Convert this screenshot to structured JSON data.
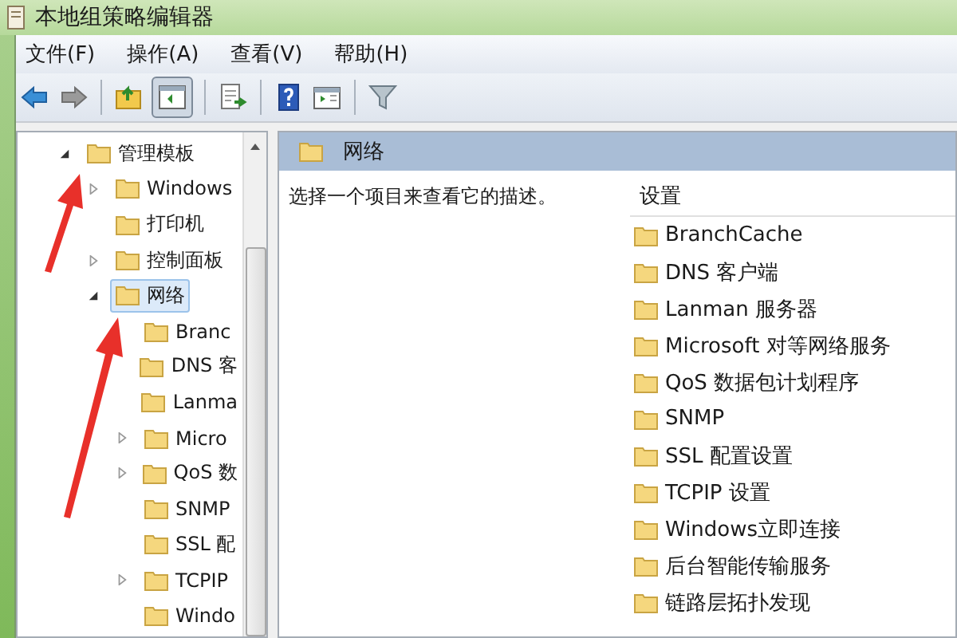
{
  "window": {
    "title": "本地组策略编辑器"
  },
  "menu": [
    {
      "label": "文件(F)"
    },
    {
      "label": "操作(A)"
    },
    {
      "label": "查看(V)"
    },
    {
      "label": "帮助(H)"
    }
  ],
  "toolbar": [
    {
      "kind": "back"
    },
    {
      "kind": "forward"
    },
    {
      "kind": "sep"
    },
    {
      "kind": "up"
    },
    {
      "kind": "tree",
      "pressed": true
    },
    {
      "kind": "sep"
    },
    {
      "kind": "export"
    },
    {
      "kind": "sep"
    },
    {
      "kind": "help"
    },
    {
      "kind": "pane"
    },
    {
      "kind": "sep"
    },
    {
      "kind": "filter"
    }
  ],
  "tree": [
    {
      "label": "管理模板",
      "expanded": true,
      "selected": false,
      "children": [
        {
          "label": "Windows",
          "expanded": false,
          "selected": false
        },
        {
          "label": "打印机",
          "selected": false
        },
        {
          "label": "控制面板",
          "expanded": false,
          "selected": false
        },
        {
          "label": "网络",
          "expanded": true,
          "selected": true,
          "children": [
            {
              "label": "Branc",
              "selected": false
            },
            {
              "label": "DNS 客",
              "selected": false
            },
            {
              "label": "Lanma",
              "selected": false
            },
            {
              "label": "Micro",
              "expanded": false,
              "selected": false
            },
            {
              "label": "QoS 数",
              "expanded": false,
              "selected": false
            },
            {
              "label": "SNMP",
              "selected": false
            },
            {
              "label": "SSL 配",
              "selected": false
            },
            {
              "label": "TCPIP",
              "expanded": false,
              "selected": false
            },
            {
              "label": "Windo",
              "selected": false
            }
          ]
        }
      ]
    }
  ],
  "details": {
    "heading": "网络",
    "description": "选择一个项目来查看它的描述。",
    "column": "设置",
    "items": [
      {
        "label": "BranchCache"
      },
      {
        "label": "DNS 客户端"
      },
      {
        "label": "Lanman 服务器"
      },
      {
        "label": "Microsoft 对等网络服务"
      },
      {
        "label": "QoS 数据包计划程序"
      },
      {
        "label": "SNMP"
      },
      {
        "label": "SSL 配置设置"
      },
      {
        "label": "TCPIP 设置"
      },
      {
        "label": "Windows立即连接"
      },
      {
        "label": "后台智能传输服务"
      },
      {
        "label": "链路层拓扑发现"
      }
    ]
  }
}
